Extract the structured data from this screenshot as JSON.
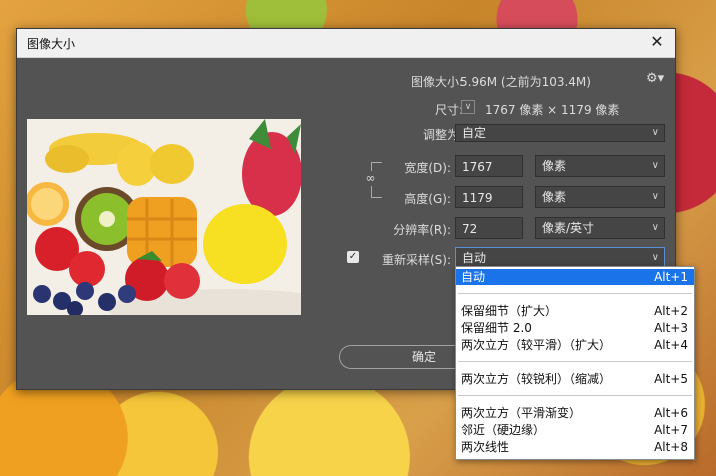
{
  "dialog": {
    "title": "图像大小",
    "close_glyph": "✕"
  },
  "image_size": {
    "label": "图像大小:",
    "value": "5.96M (之前为103.4M)"
  },
  "dimensions": {
    "label": "尺寸:",
    "value": "1767 像素 × 1179 像素"
  },
  "fit_to": {
    "label": "调整为:",
    "value": "自定"
  },
  "width": {
    "label": "宽度(D):",
    "value": "1767",
    "unit": "像素"
  },
  "height": {
    "label": "高度(G):",
    "value": "1179",
    "unit": "像素"
  },
  "resolution": {
    "label": "分辨率(R):",
    "value": "72",
    "unit": "像素/英寸"
  },
  "resample": {
    "label": "重新采样(S):",
    "checked": true,
    "value": "自动"
  },
  "ok_button": "确定",
  "resample_options": [
    {
      "name": "自动",
      "shortcut": "Alt+1",
      "selected": true
    },
    {
      "name": "保留细节（扩大）",
      "shortcut": "Alt+2"
    },
    {
      "name": "保留细节 2.0",
      "shortcut": "Alt+3"
    },
    {
      "name": "两次立方（较平滑）（扩大）",
      "shortcut": "Alt+4"
    },
    {
      "name": "两次立方（较锐利）（缩减）",
      "shortcut": "Alt+5"
    },
    {
      "name": "两次立方（平滑渐变）",
      "shortcut": "Alt+6"
    },
    {
      "name": "邻近（硬边缘）",
      "shortcut": "Alt+7"
    },
    {
      "name": "两次线性",
      "shortcut": "Alt+8"
    }
  ],
  "icons": {
    "settings": "gear-icon",
    "link": "chain-link-icon",
    "chevron": "chevron-down-icon"
  },
  "colors": {
    "dialog_bg": "#535353",
    "highlight": "#1a73e8"
  }
}
